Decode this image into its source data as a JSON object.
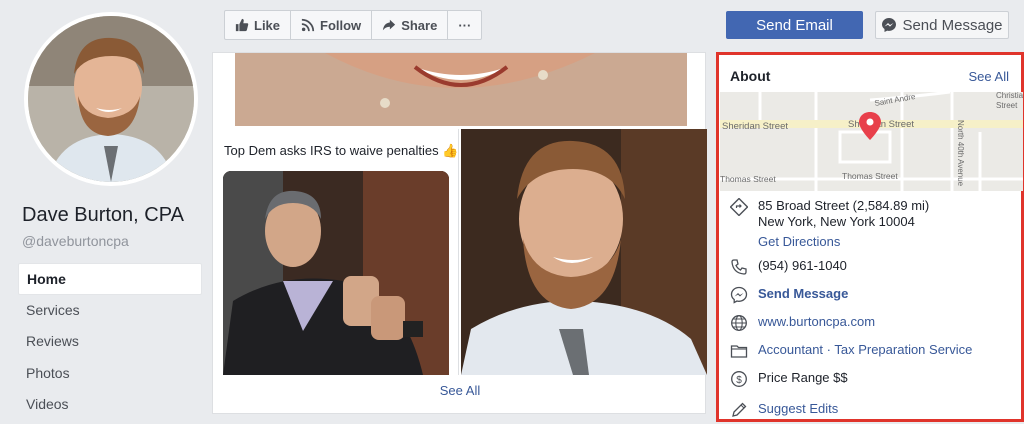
{
  "profile": {
    "name": "Dave Burton, CPA",
    "handle": "@daveburtoncpa"
  },
  "nav": {
    "items": [
      {
        "label": "Home",
        "active": true
      },
      {
        "label": "Services"
      },
      {
        "label": "Reviews"
      },
      {
        "label": "Photos"
      },
      {
        "label": "Videos"
      }
    ]
  },
  "actions": {
    "like": "Like",
    "follow": "Follow",
    "share": "Share",
    "more": "···",
    "send_email": "Send Email",
    "send_message": "Send Message"
  },
  "photos": {
    "post_caption": "Top Dem asks IRS to waive penalties 👍",
    "see_all": "See All"
  },
  "about": {
    "title": "About",
    "see_all": "See All",
    "map_labels": {
      "sheridan_left": "Sheridan Street",
      "sheridan_right": "Sheridan Street",
      "thomas_left": "Thomas Street",
      "thomas_mid": "Thomas Street",
      "saint": "Saint Andre",
      "christian": "Christia",
      "christian2": "Street",
      "north": "North 40th Avenue"
    },
    "address_line1": "85 Broad Street (2,584.89 mi)",
    "address_line2": "New York, New York 10004",
    "directions": "Get Directions",
    "phone": "(954) 961-1040",
    "message": "Send Message",
    "website": "www.burtoncpa.com",
    "category": "Accountant · Tax Preparation Service",
    "price": "Price Range $$",
    "suggest": "Suggest Edits"
  },
  "colors": {
    "brand": "#4267b2",
    "link": "#385898",
    "highlight_border": "#e0342b",
    "map_pin": "#e8404b"
  }
}
